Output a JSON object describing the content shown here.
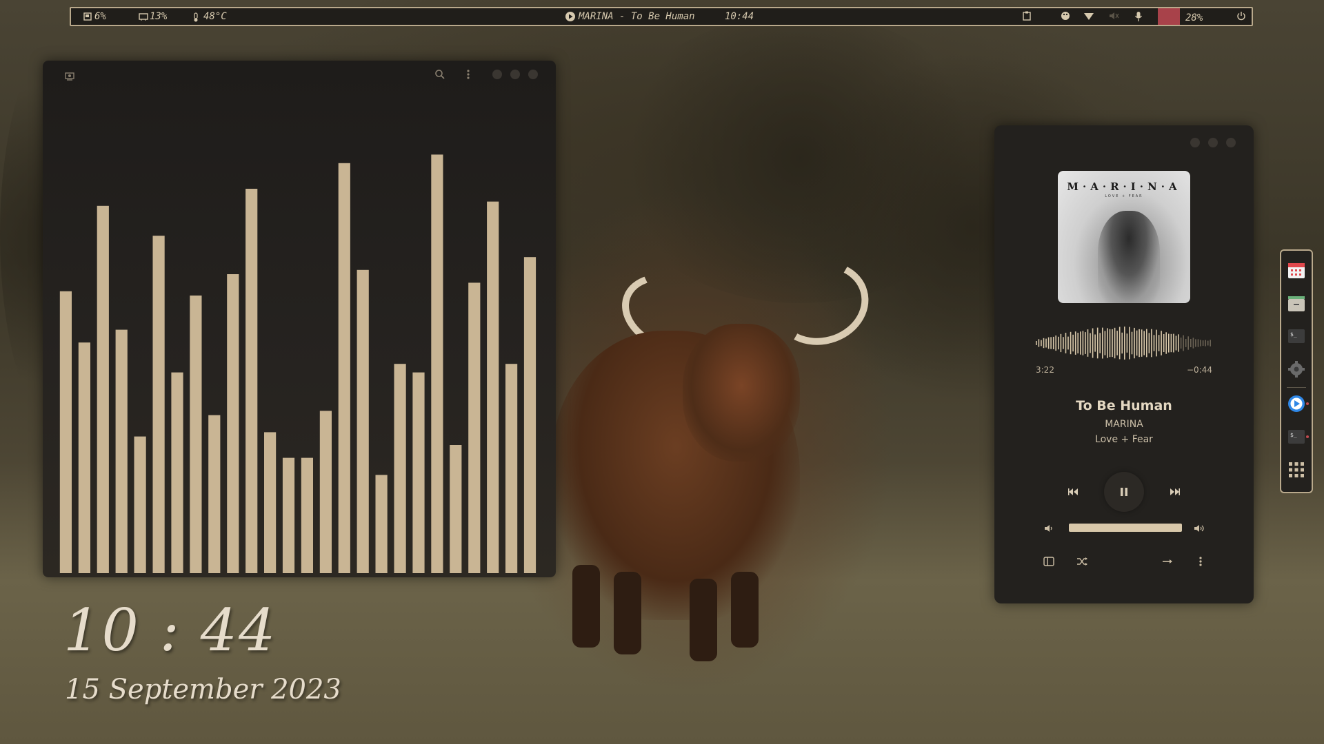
{
  "topbar": {
    "disk": "6%",
    "ram": "13%",
    "temp": "48°C",
    "now_playing": "MARINA - To Be Human",
    "time": "10:44",
    "battery": "28%"
  },
  "visualizer": {
    "levels": [
      0.66,
      0.54,
      0.86,
      0.57,
      0.32,
      0.79,
      0.47,
      0.65,
      0.37,
      0.7,
      0.9,
      0.33,
      0.27,
      0.27,
      0.38,
      0.96,
      0.71,
      0.23,
      0.49,
      0.47,
      0.98,
      0.3,
      0.68,
      0.87,
      0.49,
      0.74
    ],
    "bar_color": "#c9b594"
  },
  "clock": {
    "time": "10 : 44",
    "date": "15 September 2023"
  },
  "player": {
    "album_art_title": "M·A·R·I·N·A",
    "album_art_subtitle": "LOVE + FEAR",
    "elapsed": "3:22",
    "remaining": "−0:44",
    "progress": 0.82,
    "track": "To Be Human",
    "artist": "MARINA",
    "album": "Love + Fear",
    "volume": 1.0
  },
  "colors": {
    "accent": "#b9a98c",
    "battery_bar": "#a8424a",
    "panel_bg": "#23211e",
    "text": "#d8ccb6"
  },
  "dock": {
    "apps": [
      "calendar-icon",
      "files-icon",
      "terminal-icon",
      "settings-icon",
      "media-player-icon",
      "terminal-icon",
      "app-grid-icon"
    ]
  }
}
